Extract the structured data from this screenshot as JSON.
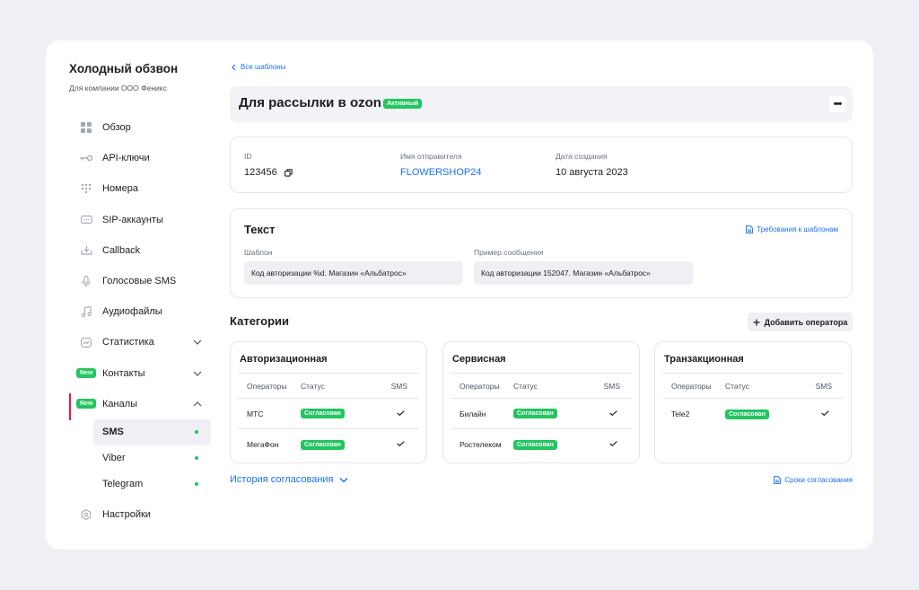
{
  "sidebar": {
    "title": "Холодный обзвон",
    "subtitle": "Для компании ООО Феникс",
    "items": [
      {
        "label": "Обзор",
        "icon": "grid-icon"
      },
      {
        "label": "API-ключи",
        "icon": "key-icon"
      },
      {
        "label": "Номера",
        "icon": "dialpad-icon"
      },
      {
        "label": "SIP-аккаунты",
        "icon": "sip-icon"
      },
      {
        "label": "Callback",
        "icon": "callback-icon"
      },
      {
        "label": "Голосовые SMS",
        "icon": "microphone-icon"
      },
      {
        "label": "Аудиофайлы",
        "icon": "music-icon"
      },
      {
        "label": "Статистика",
        "icon": "chart-icon"
      },
      {
        "label": "Контакты",
        "badge": "New"
      },
      {
        "label": "Каналы",
        "badge": "New"
      },
      {
        "label": "Настройки",
        "icon": "gear-icon"
      }
    ],
    "channels": [
      {
        "label": "SMS"
      },
      {
        "label": "Viber"
      },
      {
        "label": "Telegram"
      }
    ]
  },
  "main": {
    "back_label": "Все шаблоны",
    "title": "Для рассылки в ozon",
    "status": "Активный",
    "info": {
      "id_label": "ID",
      "id_value": "123456",
      "sender_label": "Имя отправителя",
      "sender_value": "FLOWERSHOP24",
      "date_label": "Дата создания",
      "date_value": "10 августа 2023"
    },
    "text_section": {
      "title": "Текст",
      "requirements_link": "Требования к шаблонам",
      "template_label": "Шаблон",
      "template_value": "Код авторизации %d. Магазин «Альбатрос»",
      "example_label": "Пример сообщения",
      "example_value": "Код авторизации 152047. Магазин «Альбатрос»"
    },
    "categories": {
      "title": "Категории",
      "add_operator": "Добавить оператора",
      "headers": {
        "operators": "Операторы",
        "status": "Статус",
        "sms": "SMS"
      },
      "groups": [
        {
          "name": "Авторизационная",
          "rows": [
            {
              "operator": "МТС",
              "status": "Согласован"
            },
            {
              "operator": "МегаФон",
              "status": "Согласован"
            }
          ]
        },
        {
          "name": "Сервисная",
          "rows": [
            {
              "operator": "Билайн",
              "status": "Согласован"
            },
            {
              "operator": "Ростелеком",
              "status": "Согласован"
            }
          ]
        },
        {
          "name": "Транзакционная",
          "rows": [
            {
              "operator": "Tele2",
              "status": "Согласован"
            }
          ]
        }
      ]
    },
    "history_label": "История согласования",
    "terms_link": "Сроки согласования"
  },
  "colors": {
    "accent": "#1a73e8",
    "success": "#22c55e",
    "active_marker": "#e11d48"
  }
}
